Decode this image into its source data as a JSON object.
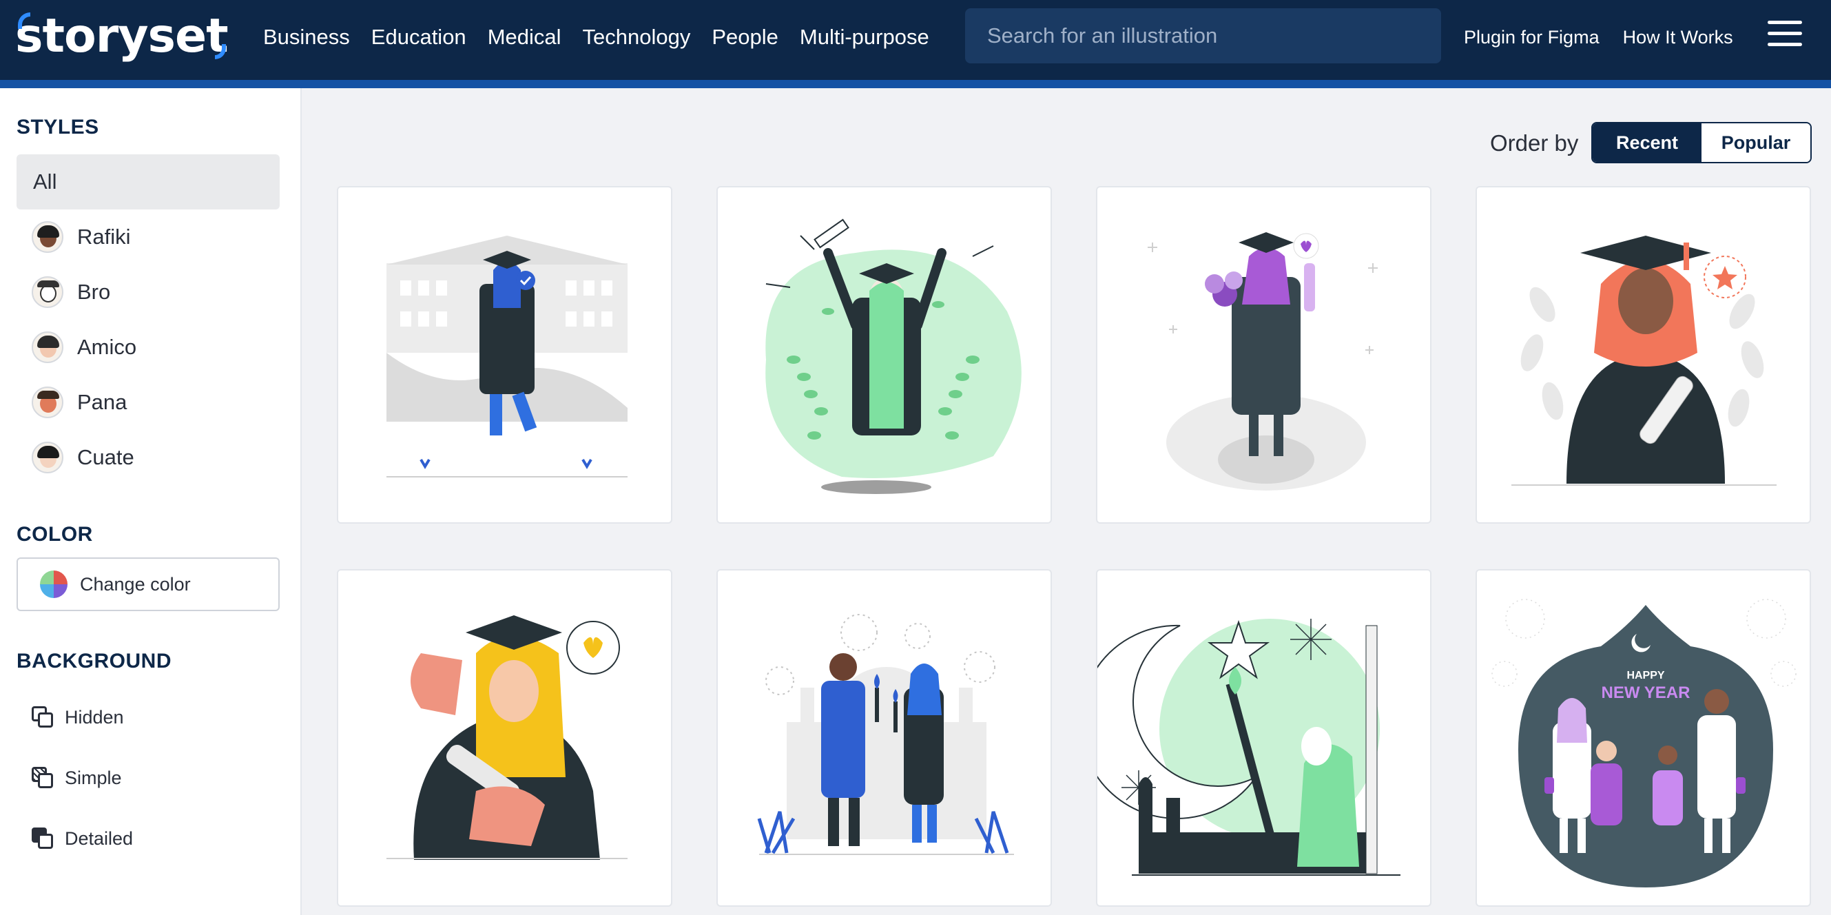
{
  "header": {
    "logo": "storyset",
    "nav": [
      "Business",
      "Education",
      "Medical",
      "Technology",
      "People",
      "Multi-purpose"
    ],
    "search_placeholder": "Search for an illustration",
    "plugin_link": "Plugin for Figma",
    "how_link": "How It Works"
  },
  "sidebar": {
    "styles_title": "STYLES",
    "styles": [
      {
        "label": "All",
        "active": true
      },
      {
        "label": "Rafiki"
      },
      {
        "label": "Bro"
      },
      {
        "label": "Amico"
      },
      {
        "label": "Pana"
      },
      {
        "label": "Cuate"
      }
    ],
    "color_title": "COLOR",
    "change_color": "Change color",
    "background_title": "BACKGROUND",
    "backgrounds": [
      "Hidden",
      "Simple",
      "Detailed"
    ]
  },
  "main": {
    "order_by": "Order by",
    "sort_options": [
      "Recent",
      "Popular"
    ],
    "selected_sort": "Recent",
    "card8_text": [
      "HAPPY",
      "NEW YEAR"
    ]
  },
  "colors": {
    "header_bg": "#0d2748",
    "accent": "#1653a4",
    "green": "#b9f0cb",
    "purple": "#9c4fd1",
    "yellow": "#f5c21b",
    "blue": "#2f5fd0",
    "coral": "#f2765a"
  }
}
